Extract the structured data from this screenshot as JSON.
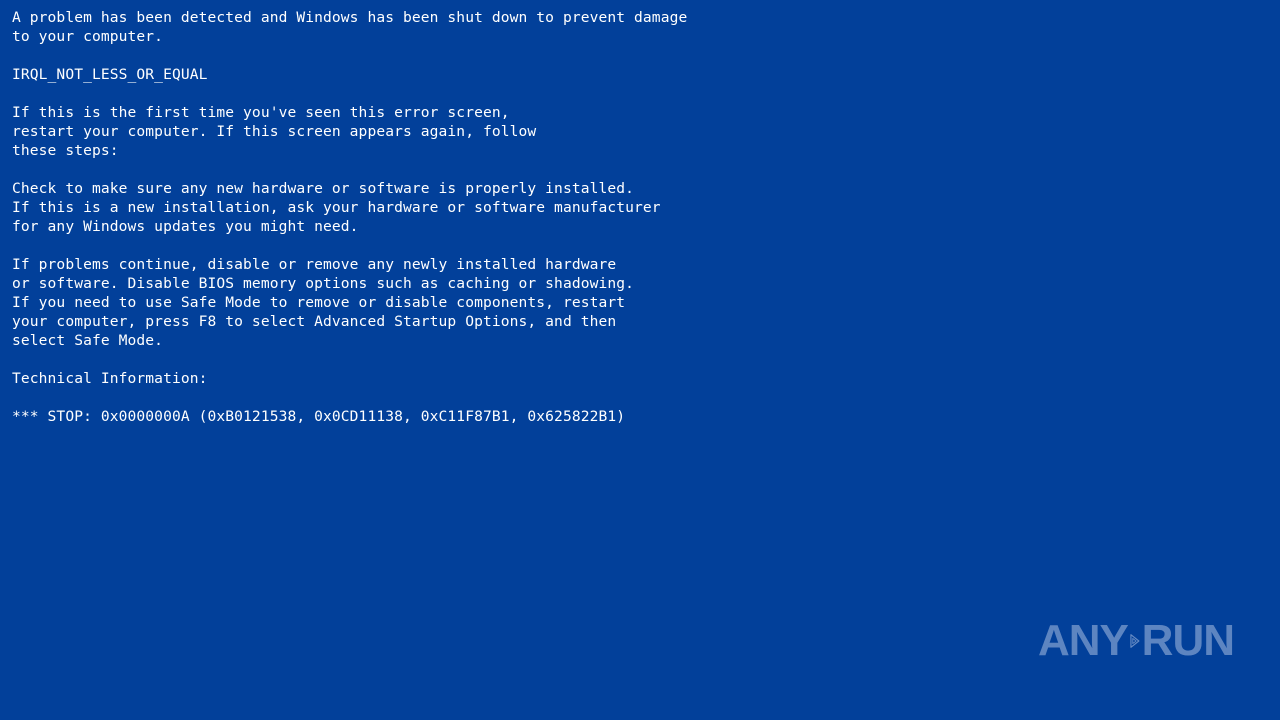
{
  "screen": {
    "background_color": "#02409a",
    "text_color": "#ffffff"
  },
  "message": {
    "intro": [
      "A problem has been detected and Windows has been shut down to prevent damage",
      "to your computer."
    ],
    "error_code": "IRQL_NOT_LESS_OR_EQUAL",
    "first_time": [
      "If this is the first time you've seen this error screen,",
      "restart your computer. If this screen appears again, follow",
      "these steps:"
    ],
    "check": [
      "Check to make sure any new hardware or software is properly installed.",
      "If this is a new installation, ask your hardware or software manufacturer",
      "for any Windows updates you might need."
    ],
    "problems": [
      "If problems continue, disable or remove any newly installed hardware",
      "or software. Disable BIOS memory options such as caching or shadowing.",
      "If you need to use Safe Mode to remove or disable components, restart",
      "your computer, press F8 to select Advanced Startup Options, and then",
      "select Safe Mode."
    ],
    "technical_heading": "Technical Information:",
    "stop_line": "*** STOP: 0x0000000A (0xB0121538, 0x0CD11138, 0xC11F87B1, 0x625822B1)"
  },
  "watermark": {
    "left_text": "ANY",
    "icon": "play-triangle-icon",
    "right_text": "RUN"
  }
}
